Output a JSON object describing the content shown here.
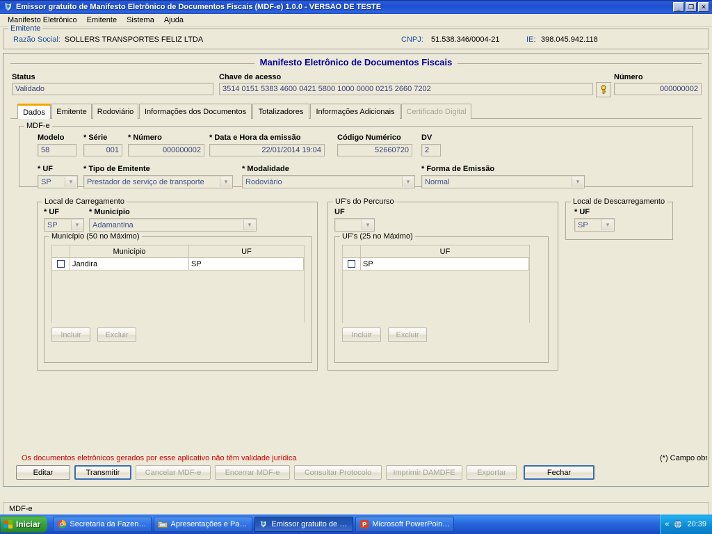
{
  "window": {
    "title": "Emissor gratuito de Manifesto Eletrônico de Documentos Fiscais (MDF-e) 1.0.0 - VERSÃO DE TESTE",
    "minimize_label": "_",
    "restore_label": "❐",
    "close_label": "✕"
  },
  "menubar": {
    "items": [
      {
        "label": "Manifesto Eletrônico"
      },
      {
        "label": "Emitente"
      },
      {
        "label": "Sistema"
      },
      {
        "label": "Ajuda"
      }
    ]
  },
  "emitente": {
    "legend": "Emitente",
    "razao_label": "Razão Social:",
    "razao_value": "SOLLERS TRANSPORTES FELIZ LTDA",
    "cnpj_label": "CNPJ:",
    "cnpj_value": "51.538.346/0004-21",
    "ie_label": "IE:",
    "ie_value": "398.045.942.118"
  },
  "panel": {
    "title": "Manifesto Eletrônico de Documentos Fiscais",
    "status_label": "Status",
    "status_value": "Validado",
    "chave_label": "Chave de acesso",
    "chave_value": "3514 0151 5383 4600 0421 5800 1000 0000 0215 2660 7202",
    "key_icon": "key-icon",
    "numero_label": "Número",
    "numero_value": "000000002"
  },
  "tabs": [
    {
      "label": "Dados",
      "state": "active"
    },
    {
      "label": "Emitente",
      "state": "normal"
    },
    {
      "label": "Rodoviário",
      "state": "normal"
    },
    {
      "label": "Informações dos Documentos",
      "state": "normal"
    },
    {
      "label": "Totalizadores",
      "state": "normal"
    },
    {
      "label": "Informações Adicionais",
      "state": "normal"
    },
    {
      "label": "Certificado Digital",
      "state": "disabled"
    }
  ],
  "mdfe_group": {
    "legend": "MDF-e",
    "modelo_label": "Modelo",
    "modelo_value": "58",
    "serie_label": "* Série",
    "serie_value": "001",
    "numero_label": "* Número",
    "numero_value": "000000002",
    "datahora_label": "* Data e Hora da emissão",
    "datahora_value": "22/01/2014 19:04",
    "codigo_label": "Código Numérico",
    "codigo_value": "52660720",
    "dv_label": "DV",
    "dv_value": "2",
    "uf_label": "* UF",
    "uf_value": "SP",
    "tipo_emitente_label": "* Tipo de Emitente",
    "tipo_emitente_value": "Prestador de serviço de transporte",
    "modalidade_label": "* Modalidade",
    "modalidade_value": "Rodoviário",
    "forma_emissao_label": "* Forma de Emissão",
    "forma_emissao_value": "Normal"
  },
  "carregamento": {
    "legend": "Local de Carregamento",
    "uf_label": "* UF",
    "uf_value": "SP",
    "municipio_label": "* Município",
    "municipio_value": "Adamantina",
    "table_legend": "Município (50 no Máximo)",
    "columns": [
      "",
      "Município",
      "UF"
    ],
    "rows": [
      {
        "checked": false,
        "municipio": "Jandira",
        "uf": "SP"
      }
    ],
    "incluir_label": "Incluir",
    "excluir_label": "Excluir"
  },
  "percurso": {
    "legend": "UF's do Percurso",
    "uf_label": "UF",
    "uf_value": "",
    "table_legend": "UF's (25 no Máximo)",
    "columns": [
      "",
      "UF"
    ],
    "rows": [
      {
        "checked": false,
        "uf": "SP"
      }
    ],
    "incluir_label": "Incluir",
    "excluir_label": "Excluir"
  },
  "descarregamento": {
    "legend": "Local de Descarregamento",
    "uf_label": "* UF",
    "uf_value": "SP"
  },
  "footer": {
    "warning": "Os documentos eletrônicos gerados por esse aplicativo não têm validade jurídica",
    "campo_note": "(*) Campo obrigatório",
    "buttons": [
      {
        "label": "Editar",
        "state": "enabled"
      },
      {
        "label": "Transmitir",
        "state": "default"
      },
      {
        "label": "Cancelar MDF-e",
        "state": "disabled"
      },
      {
        "label": "Encerrar MDF-e",
        "state": "disabled"
      },
      {
        "label": "Consultar Protocolo",
        "state": "disabled"
      },
      {
        "label": "Imprimir DAMDFE",
        "state": "disabled"
      },
      {
        "label": "Exportar",
        "state": "disabled"
      },
      {
        "label": "Fechar",
        "state": "default"
      }
    ]
  },
  "appstatus": {
    "text": "MDF-e"
  },
  "taskbar": {
    "start_label": "Iniciar",
    "tasks": [
      {
        "label": "Secretaria da Fazenda | ...",
        "icon": "chrome-icon",
        "active": false
      },
      {
        "label": "Apresentações e Palestras",
        "icon": "folder-icon",
        "active": false
      },
      {
        "label": "Emissor gratuito de M...",
        "icon": "mdfe-icon",
        "active": true
      },
      {
        "label": "Microsoft PowerPoint - [...",
        "icon": "powerpoint-icon",
        "active": false
      }
    ],
    "tray_chevron": "«",
    "tray_icon": "globe-icon",
    "clock": "20:39"
  }
}
